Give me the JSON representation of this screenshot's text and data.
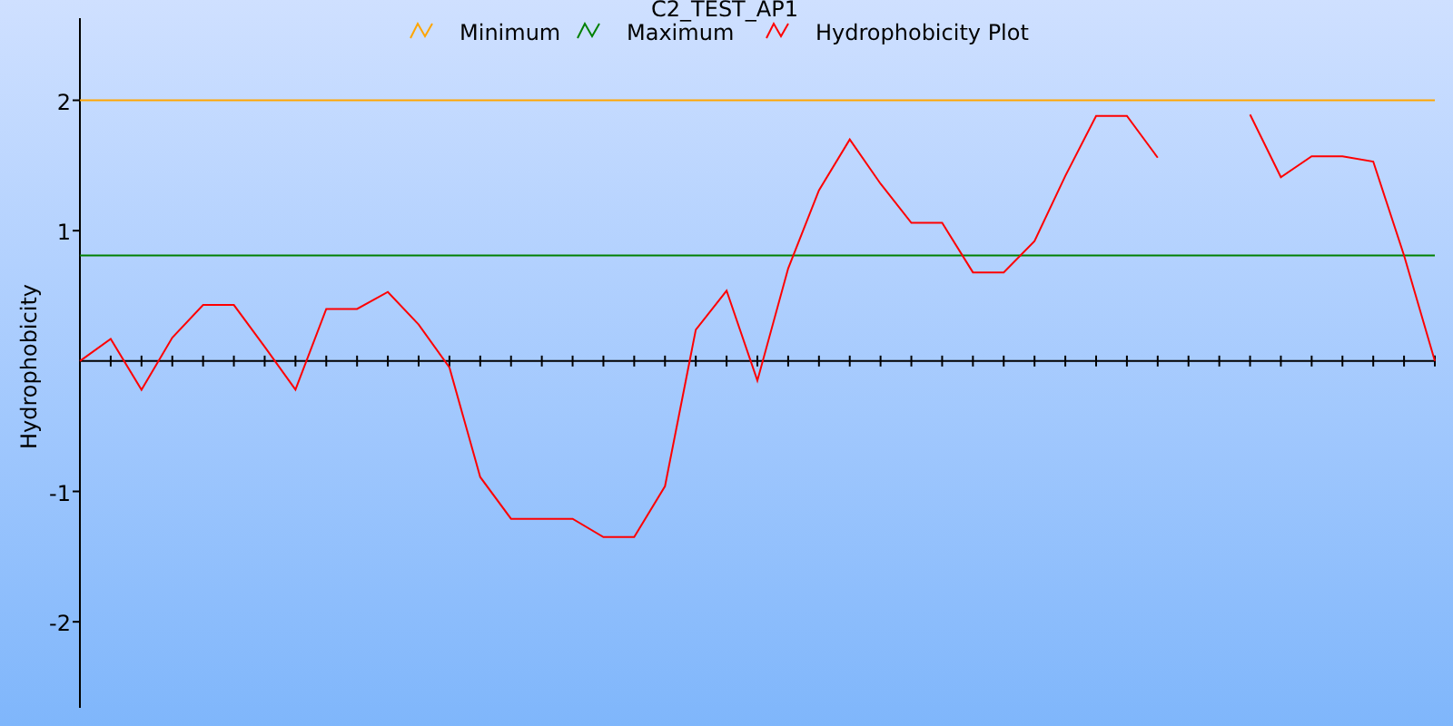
{
  "chart_data": {
    "type": "line",
    "title": "C2_TEST_AP1",
    "ylabel": "Hydrophobicity",
    "categories": [
      null,
      null,
      null,
      null,
      null,
      null,
      null,
      null,
      null,
      null,
      null,
      null,
      null,
      null,
      null,
      null,
      null,
      null,
      null,
      null,
      null,
      null,
      null,
      null,
      null,
      null,
      null,
      null,
      null,
      null,
      null,
      null,
      null,
      null,
      null,
      null,
      null,
      null,
      null,
      null,
      null,
      null,
      null,
      null,
      null
    ],
    "ylim": [
      -2.66,
      2.63
    ],
    "yticks": [
      -2,
      -1,
      1,
      2
    ],
    "legend": "top",
    "series": [
      {
        "name": "Minimum",
        "color": "#ffa500",
        "values": [
          2,
          2,
          2,
          2,
          2,
          2,
          2,
          2,
          2,
          2,
          2,
          2,
          2,
          2,
          2,
          2,
          2,
          2,
          2,
          2,
          2,
          2,
          2,
          2,
          2,
          2,
          2,
          2,
          2,
          2,
          2,
          2,
          2,
          2,
          2,
          2,
          2,
          2,
          2,
          2,
          2,
          2,
          2,
          2,
          2
        ]
      },
      {
        "name": "Maximum",
        "color": "#008000",
        "values": [
          0.81,
          0.81,
          0.81,
          0.81,
          0.81,
          0.81,
          0.81,
          0.81,
          0.81,
          0.81,
          0.81,
          0.81,
          0.81,
          0.81,
          0.81,
          0.81,
          0.81,
          0.81,
          0.81,
          0.81,
          0.81,
          0.81,
          0.81,
          0.81,
          0.81,
          0.81,
          0.81,
          0.81,
          0.81,
          0.81,
          0.81,
          0.81,
          0.81,
          0.81,
          0.81,
          0.81,
          0.81,
          0.81,
          0.81,
          0.81,
          0.81,
          0.81,
          0.81,
          0.81,
          0.81
        ]
      },
      {
        "name": "Hydrophobicity Plot",
        "color": "#ff0000",
        "values": [
          0,
          0.17,
          -0.22,
          0.18,
          0.43,
          0.43,
          0.11,
          -0.22,
          0.4,
          0.4,
          0.53,
          0.28,
          -0.05,
          -0.89,
          -1.21,
          -1.21,
          -1.21,
          -1.35,
          -1.35,
          -0.96,
          0.24,
          0.54,
          -0.15,
          0.71,
          1.31,
          1.7,
          1.36,
          1.06,
          1.06,
          0.68,
          0.68,
          0.92,
          1.42,
          1.88,
          1.88,
          1.56,
          null,
          null,
          1.89,
          1.41,
          1.57,
          1.57,
          1.53,
          0.81,
          0
        ]
      }
    ]
  }
}
